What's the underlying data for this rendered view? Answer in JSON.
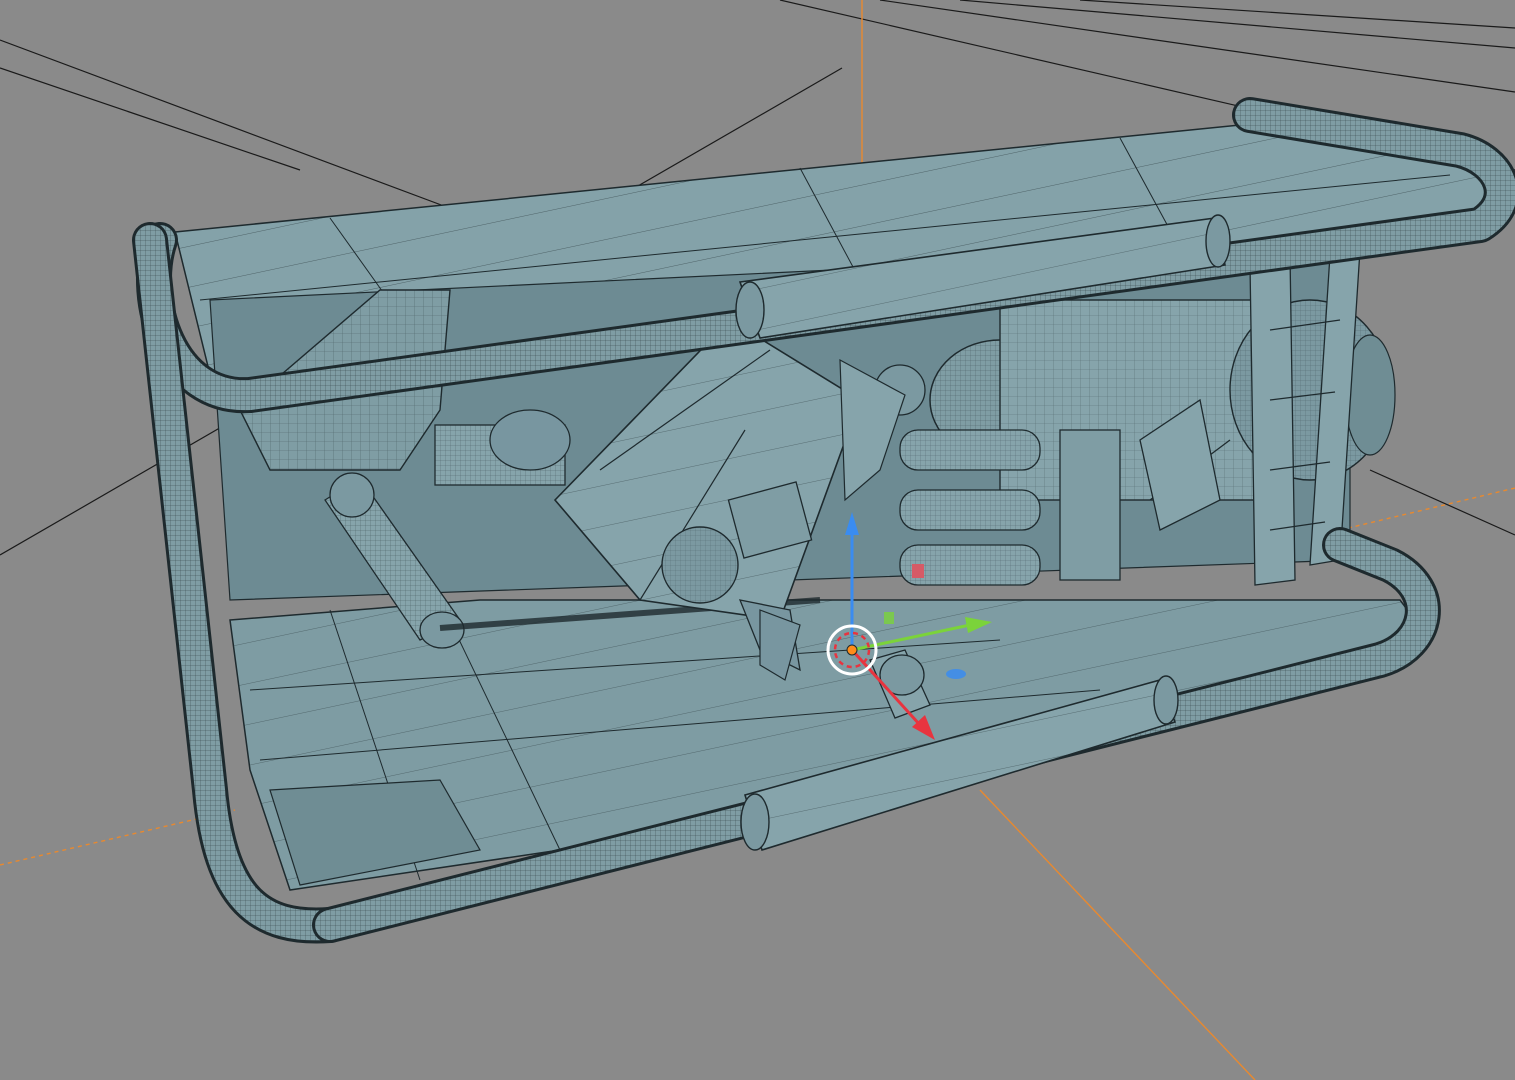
{
  "viewport": {
    "background": "#8a8a8a",
    "mesh_fill": "#7b98a0",
    "mesh_fill_light": "#8aa7ae",
    "mesh_fill_dark": "#5f7c84",
    "wire_color": "#1e2a2e",
    "guide_line_color": "#1a1a1a",
    "axis_line_color": "#e8892f"
  },
  "gizmo": {
    "x_axis_color": "#e8343f",
    "y_axis_color": "#7bd33a",
    "z_axis_color": "#3a8cf0",
    "pivot_color": "#ff8c1a",
    "cursor_ring_color": "#ffffff"
  },
  "object": {
    "icon": "generator-frame-wireframe-icon"
  }
}
